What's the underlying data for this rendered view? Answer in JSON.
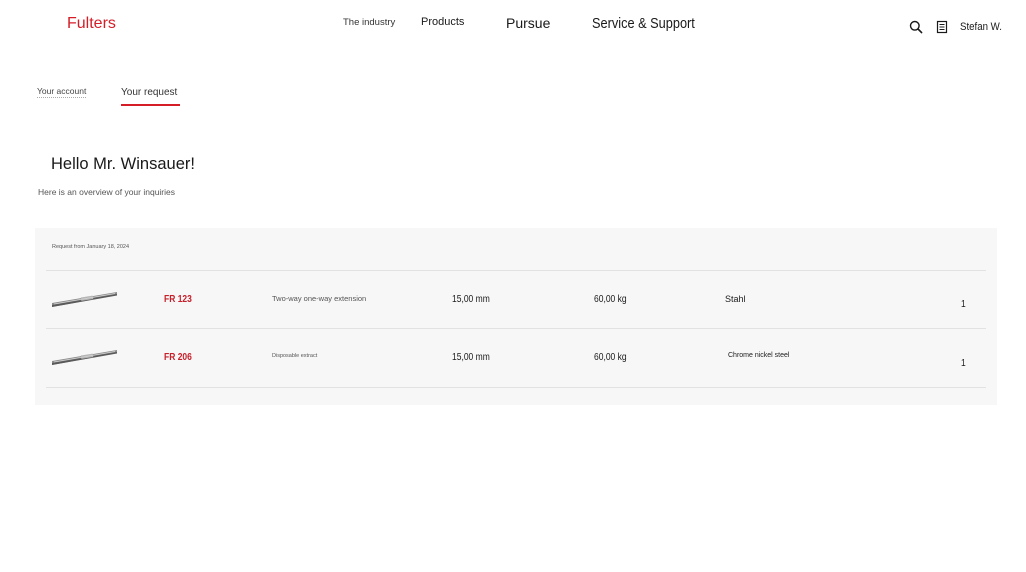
{
  "header": {
    "logo": "Fulters",
    "nav": [
      "The industry",
      "Products",
      "Pursue",
      "Service & Support"
    ],
    "user_name": "Stefan W."
  },
  "icons": {
    "search": "search-icon",
    "document": "document-icon"
  },
  "tabs": {
    "account": "Your account",
    "request": "Your request"
  },
  "greeting": {
    "title": "Hello Mr. Winsauer!",
    "subtitle": "Here is an overview of your inquiries"
  },
  "request": {
    "title": "Request from January 18, 2024",
    "rows": [
      {
        "code": "FR 123",
        "description": "Two-way one-way extension",
        "width": "15,00 mm",
        "load": "60,00 kg",
        "material": "Stahl",
        "quantity": "1"
      },
      {
        "code": "FR 206",
        "description": "Disposable extract",
        "width": "15,00 mm",
        "load": "60,00 kg",
        "material": "Chrome nickel steel",
        "quantity": "1"
      }
    ]
  },
  "colors": {
    "accent": "#d51d28",
    "card_background": "#f7f7f7",
    "divider": "#e2e2e2"
  }
}
